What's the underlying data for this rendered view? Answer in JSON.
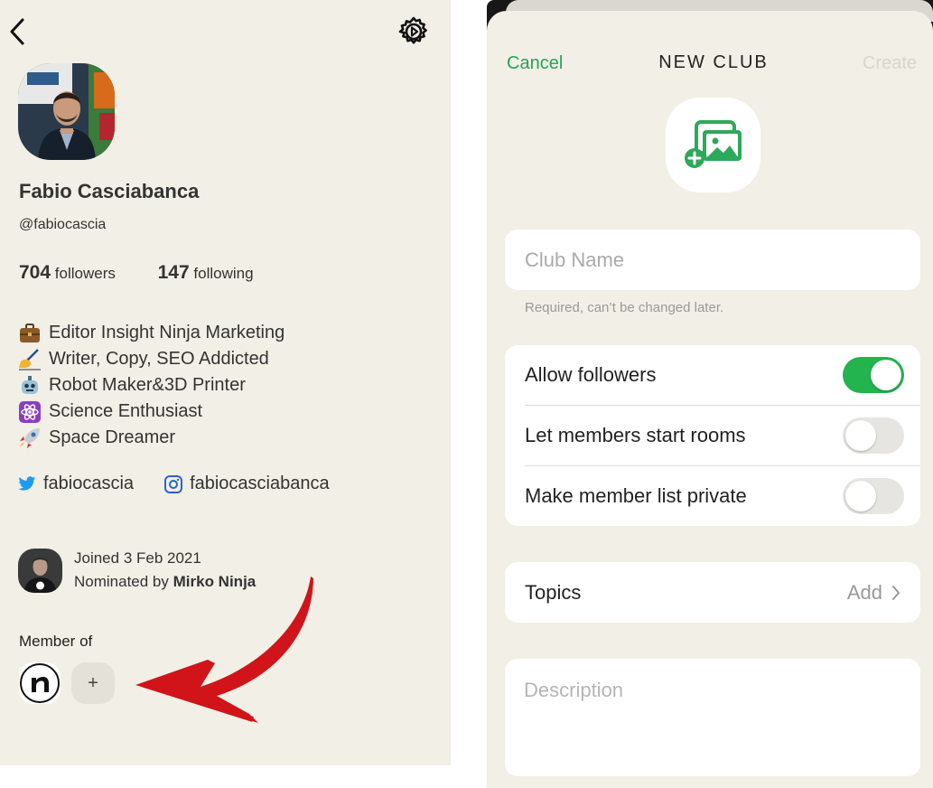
{
  "profile": {
    "name": "Fabio Casciabanca",
    "handle": "@fabiocascia",
    "followers_count": "704",
    "followers_label": "followers",
    "following_count": "147",
    "following_label": "following",
    "bio": [
      {
        "icon": "briefcase-emoji",
        "text": "Editor Insight Ninja Marketing"
      },
      {
        "icon": "writing-hand-emoji",
        "text": "Writer, Copy, SEO Addicted"
      },
      {
        "icon": "robot-emoji",
        "text": "Robot Maker&3D Printer"
      },
      {
        "icon": "atom-emoji",
        "text": "Science Enthusiast"
      },
      {
        "icon": "rocket-emoji",
        "text": "Space Dreamer"
      }
    ],
    "twitter": "fabiocascia",
    "instagram": "fabiocasciabanca",
    "joined": "Joined 3 Feb 2021",
    "nominated_prefix": "Nominated by ",
    "nominated_by": "Mirko Ninja",
    "member_of_label": "Member of",
    "add_club_label": "+",
    "accent_arrow_color": "#d0141a"
  },
  "new_club": {
    "cancel_label": "Cancel",
    "title": "NEW CLUB",
    "create_label": "Create",
    "club_name_placeholder": "Club Name",
    "club_name_helper": "Required, can’t be changed later.",
    "settings": [
      {
        "label": "Allow followers",
        "enabled": true
      },
      {
        "label": "Let members start rooms",
        "enabled": false
      },
      {
        "label": "Make member list private",
        "enabled": false
      }
    ],
    "topics_label": "Topics",
    "topics_action": "Add",
    "description_placeholder": "Description",
    "accent_color": "#23a455"
  }
}
